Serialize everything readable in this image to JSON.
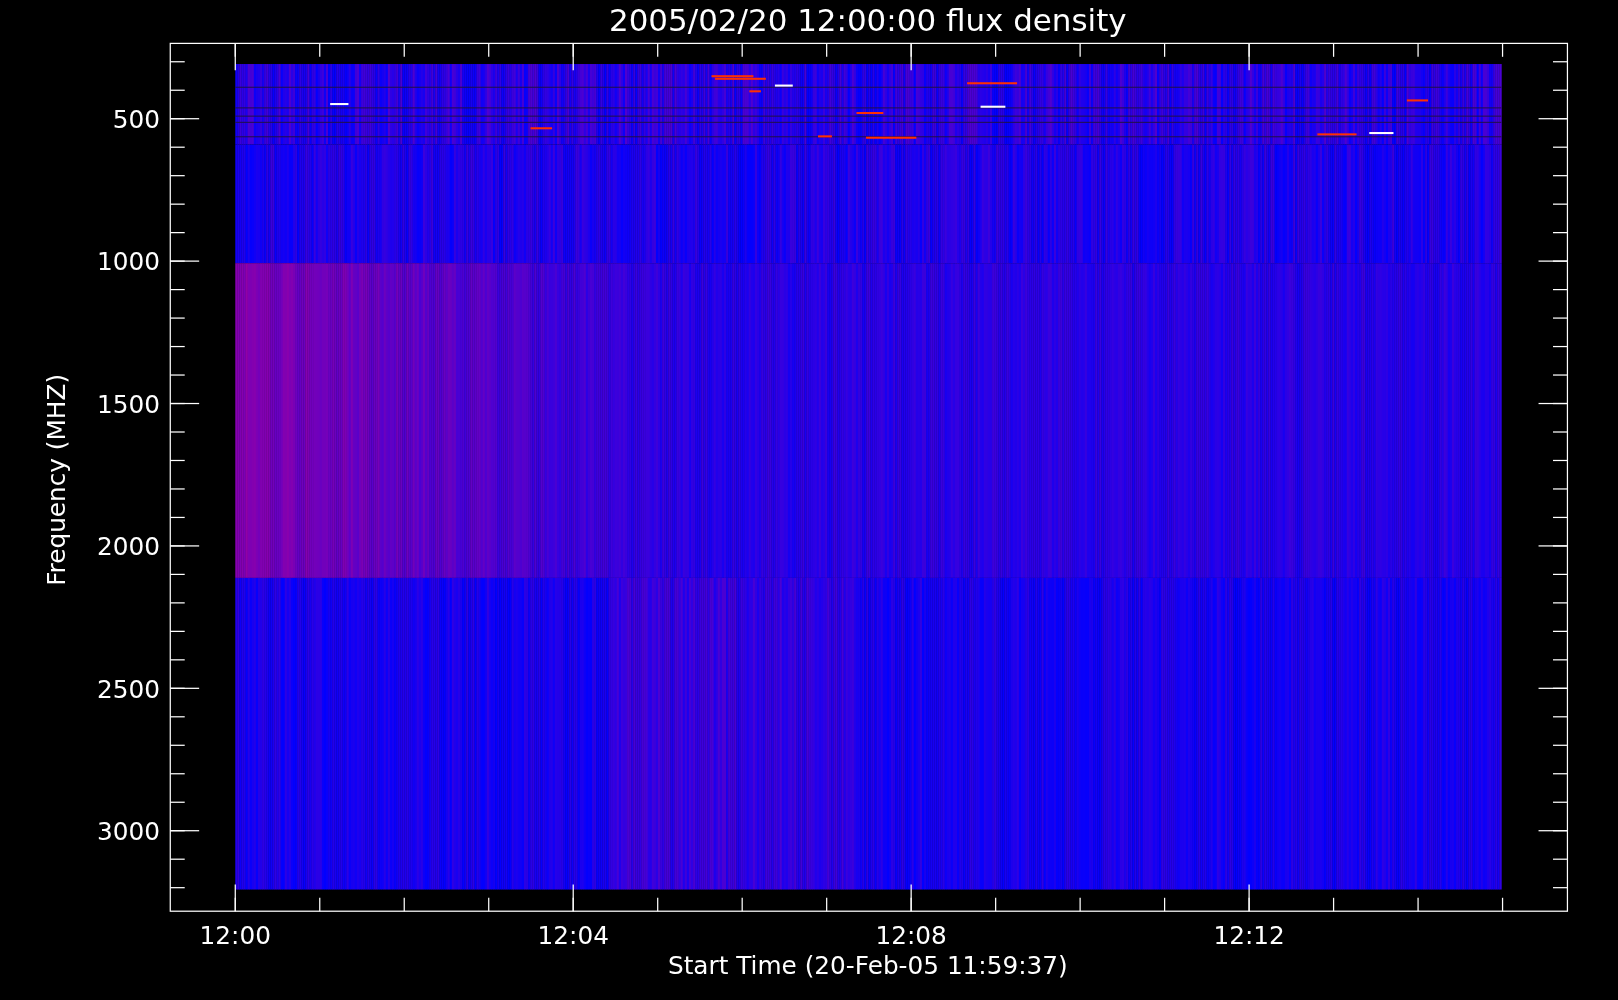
{
  "chart": {
    "title": "2005/02/20 12:00:00 flux density",
    "xlabel": "Start Time (20-Feb-05 11:59:37)",
    "ylabel": "Frequency (MHZ)",
    "xticks": [
      "12:00",
      "12:04",
      "12:08",
      "12:12"
    ],
    "yticks": [
      "500",
      "1000",
      "1500",
      "2000",
      "2500",
      "3000"
    ]
  }
}
